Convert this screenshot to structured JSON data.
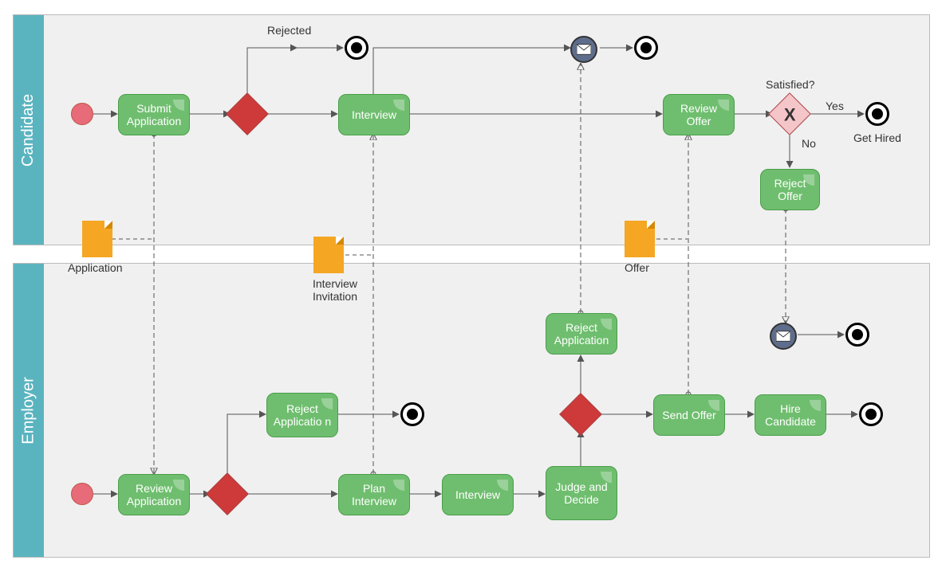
{
  "lanes": {
    "candidate": "Candidate",
    "employer": "Employer"
  },
  "candidate": {
    "submit": "Submit Application",
    "interview": "Interview",
    "reviewOffer": "Review Offer",
    "rejectOffer": "Reject Offer",
    "rejected": "Rejected",
    "satisfied": "Satisfied?",
    "yes": "Yes",
    "no": "No",
    "getHired": "Get Hired"
  },
  "employer": {
    "review": "Review Application",
    "rejectApp": "Reject Applicatio n",
    "plan": "Plan Interview",
    "interview": "Interview",
    "judge": "Judge and Decide",
    "rejectApp2": "Reject Application",
    "send": "Send Offer",
    "hire": "Hire Candidate"
  },
  "docs": {
    "application": "Application",
    "invitation": "Interview Invitation",
    "offer": "Offer"
  },
  "chart_data": {
    "type": "bpmn",
    "pools": [
      {
        "name": "Candidate",
        "elements": [
          {
            "id": "c_start",
            "type": "startEvent"
          },
          {
            "id": "c_submit",
            "type": "task",
            "label": "Submit Application"
          },
          {
            "id": "c_gw1",
            "type": "exclusiveGateway"
          },
          {
            "id": "c_end_rej",
            "type": "endEvent",
            "label": "Rejected"
          },
          {
            "id": "c_interview",
            "type": "task",
            "label": "Interview"
          },
          {
            "id": "c_msg",
            "type": "messageIntermediateEvent"
          },
          {
            "id": "c_end2",
            "type": "endEvent"
          },
          {
            "id": "c_review",
            "type": "task",
            "label": "Review Offer"
          },
          {
            "id": "c_gw2",
            "type": "exclusiveGateway",
            "label": "Satisfied?"
          },
          {
            "id": "c_end_hired",
            "type": "endEvent",
            "label": "Get Hired"
          },
          {
            "id": "c_reject",
            "type": "task",
            "label": "Reject Offer"
          }
        ]
      },
      {
        "name": "Employer",
        "elements": [
          {
            "id": "e_start",
            "type": "startEvent"
          },
          {
            "id": "e_review",
            "type": "task",
            "label": "Review Application"
          },
          {
            "id": "e_gw1",
            "type": "exclusiveGateway"
          },
          {
            "id": "e_rejapp",
            "type": "task",
            "label": "Reject Application"
          },
          {
            "id": "e_end1",
            "type": "endEvent"
          },
          {
            "id": "e_plan",
            "type": "task",
            "label": "Plan Interview"
          },
          {
            "id": "e_interview",
            "type": "task",
            "label": "Interview"
          },
          {
            "id": "e_judge",
            "type": "task",
            "label": "Judge and Decide"
          },
          {
            "id": "e_gw2",
            "type": "exclusiveGateway"
          },
          {
            "id": "e_rejapp2",
            "type": "task",
            "label": "Reject Application"
          },
          {
            "id": "e_send",
            "type": "task",
            "label": "Send Offer"
          },
          {
            "id": "e_hire",
            "type": "task",
            "label": "Hire Candidate"
          },
          {
            "id": "e_end2",
            "type": "endEvent"
          },
          {
            "id": "e_msg",
            "type": "messageIntermediateEvent"
          },
          {
            "id": "e_end3",
            "type": "endEvent"
          }
        ]
      }
    ],
    "dataObjects": [
      {
        "id": "d_app",
        "label": "Application"
      },
      {
        "id": "d_inv",
        "label": "Interview Invitation"
      },
      {
        "id": "d_offer",
        "label": "Offer"
      }
    ],
    "sequenceFlows": [
      [
        "c_start",
        "c_submit"
      ],
      [
        "c_submit",
        "c_gw1"
      ],
      [
        "c_gw1",
        "c_end_rej",
        "Rejected"
      ],
      [
        "c_gw1",
        "c_interview"
      ],
      [
        "c_interview",
        "c_msg"
      ],
      [
        "c_msg",
        "c_end2"
      ],
      [
        "c_interview",
        "c_review"
      ],
      [
        "c_review",
        "c_gw2"
      ],
      [
        "c_gw2",
        "c_end_hired",
        "Yes"
      ],
      [
        "c_gw2",
        "c_reject",
        "No"
      ],
      [
        "e_start",
        "e_review"
      ],
      [
        "e_review",
        "e_gw1"
      ],
      [
        "e_gw1",
        "e_rejapp"
      ],
      [
        "e_rejapp",
        "e_end1"
      ],
      [
        "e_gw1",
        "e_plan"
      ],
      [
        "e_plan",
        "e_interview"
      ],
      [
        "e_interview",
        "e_judge"
      ],
      [
        "e_judge",
        "e_gw2"
      ],
      [
        "e_gw2",
        "e_rejapp2"
      ],
      [
        "e_gw2",
        "e_send"
      ],
      [
        "e_send",
        "e_hire"
      ],
      [
        "e_hire",
        "e_end2"
      ],
      [
        "e_msg",
        "e_end3"
      ]
    ],
    "messageFlows": [
      [
        "c_submit",
        "e_review",
        "Application"
      ],
      [
        "e_plan",
        "c_interview",
        "Interview Invitation"
      ],
      [
        "e_rejapp2",
        "c_msg"
      ],
      [
        "e_send",
        "c_review",
        "Offer"
      ],
      [
        "c_reject",
        "e_msg"
      ]
    ]
  }
}
